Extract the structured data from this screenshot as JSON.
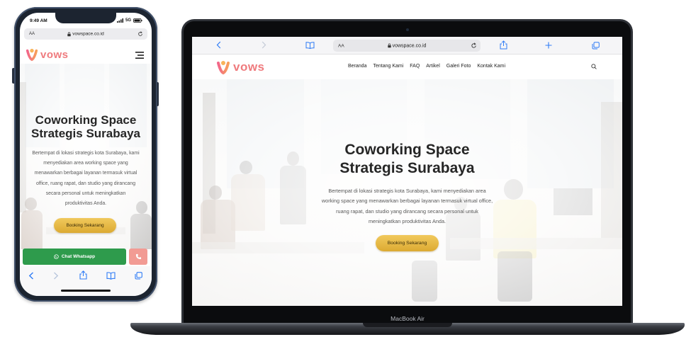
{
  "phone": {
    "status_bar": {
      "time": "9:49 AM",
      "network": "5G"
    },
    "browser": {
      "text_size_label": "AA",
      "url": "vowspace.co.id"
    },
    "site": {
      "logo_text": "vows"
    },
    "hero": {
      "title_lines": [
        "Coworking Space",
        "Strategis Surabaya"
      ],
      "description_lines": [
        "Bertempat di lokasi strategis kota Surabaya, kami",
        "menyediakan area working space yang",
        "menawarkan berbagai layanan termasuk virtual",
        "office, ruang rapat, dan studio yang dirancang",
        "secara personal untuk meningkatkan",
        "produktivitas Anda."
      ],
      "cta_label": "Booking Sekarang"
    },
    "floating_bar": {
      "whatsapp_label": "Chat Whatsapp"
    },
    "icons": [
      "signal-icon",
      "battery-icon",
      "lock-icon",
      "reload-icon",
      "menu-icon",
      "whatsapp-icon",
      "phone-icon",
      "chevron-left-icon",
      "chevron-right-icon",
      "share-icon",
      "bookmarks-icon",
      "tabs-icon"
    ]
  },
  "laptop": {
    "browser": {
      "text_size_label": "AA",
      "url": "vowspace.co.id"
    },
    "site": {
      "logo_text": "vows",
      "nav": [
        {
          "label": "Beranda"
        },
        {
          "label": "Tentang Kami"
        },
        {
          "label": "FAQ"
        },
        {
          "label": "Artikel"
        },
        {
          "label": "Galeri Foto"
        },
        {
          "label": "Kontak Kami"
        }
      ]
    },
    "hero": {
      "title_lines": [
        "Coworking Space",
        "Strategis Surabaya"
      ],
      "description_lines": [
        "Bertempat di lokasi strategis kota Surabaya, kami menyediakan area",
        "working space yang menawarkan berbagai layanan termasuk virtual office,",
        "ruang rapat, dan studio yang dirancang secara personal untuk",
        "meningkatkan produktivitas Anda."
      ],
      "cta_label": "Booking Sekarang"
    },
    "device_label": "MacBook Air",
    "icons": [
      "chevron-left-icon",
      "chevron-right-icon",
      "bookmarks-icon",
      "lock-icon",
      "reload-icon",
      "share-icon",
      "plus-icon",
      "tabs-icon",
      "search-icon"
    ]
  },
  "colors": {
    "brand_coral": "#ef7b7e",
    "cta_gold": "#e2b33c",
    "whatsapp_green": "#2e9b4c",
    "call_pink": "#f29b94",
    "device_frame": "#1c2430"
  }
}
